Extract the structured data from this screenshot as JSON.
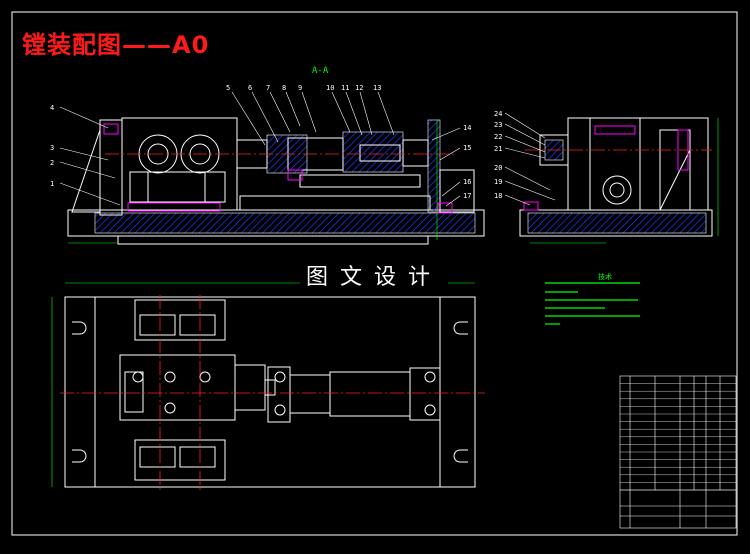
{
  "drawing": {
    "title": "镗装配图——A0",
    "watermark": "图文设计",
    "section_label": "A-A",
    "tech_requirements_title": "技术"
  },
  "balloons_front": [
    "1",
    "2",
    "3",
    "4",
    "5",
    "6",
    "7",
    "8",
    "9",
    "10",
    "11",
    "12",
    "13",
    "14",
    "15",
    "16",
    "17"
  ],
  "balloons_side": [
    "18",
    "19",
    "20",
    "21",
    "22",
    "23",
    "24"
  ],
  "colors": {
    "background": "#000000",
    "outline": "#ffffff",
    "centerline": "#ff2020",
    "hatch": "#1e3cff",
    "dimension": "#00ff00",
    "highlight": "#ff00ff",
    "title_text": "#ff1a1a"
  }
}
